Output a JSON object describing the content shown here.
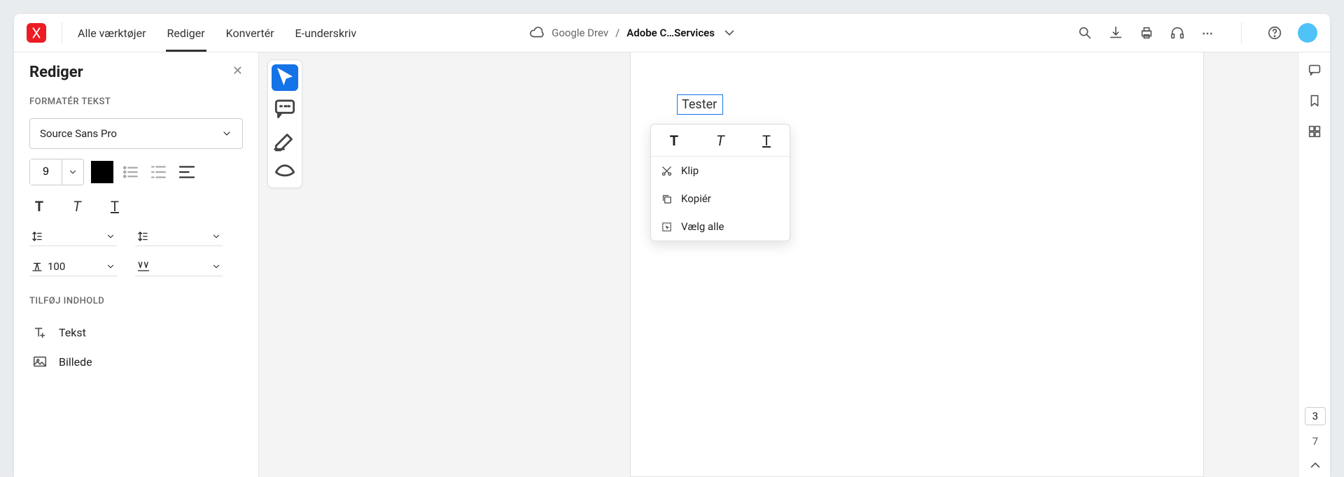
{
  "nav": {
    "all_tools": "Alle værktøjer",
    "edit": "Rediger",
    "convert": "Konvertér",
    "esign": "E-underskriv"
  },
  "breadcrumb": {
    "source": "Google Drev",
    "sep": "/",
    "doc": "Adobe C…Services"
  },
  "panel": {
    "title": "Rediger",
    "section_format": "FORMATÉR TEKST",
    "font": "Source Sans Pro",
    "font_size": "9",
    "scale": "100",
    "section_add": "TILFØJ INDHOLD",
    "add_text": "Tekst",
    "add_image": "Billede"
  },
  "doc": {
    "selected_text": "Tester"
  },
  "ctx": {
    "cut": "Klip",
    "copy": "Kopiér",
    "select_all": "Vælg alle"
  },
  "pages": {
    "current": "3",
    "total": "7"
  }
}
